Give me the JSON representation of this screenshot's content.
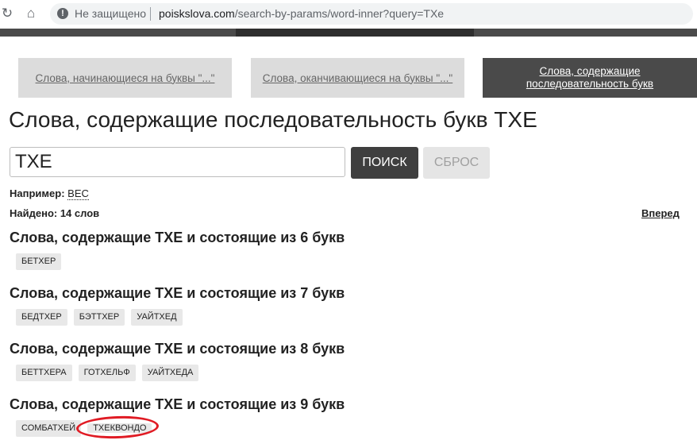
{
  "browser": {
    "security_label": "Не защищено",
    "url_host": "poiskslova.com",
    "url_path": "/search-by-params/word-inner?query=TXe"
  },
  "colors": {
    "tab_active": "#4a4a4a",
    "tab_inactive": "#dcdcdc",
    "chip_bg": "#e8e8e8",
    "annotation": "#e01b24"
  },
  "tabs": [
    {
      "label": "Слова, начинающиеся на буквы \"...\""
    },
    {
      "label": "Слова, оканчивающиеся на буквы \"...\""
    },
    {
      "label": "Слова, содержащие последовательность букв"
    }
  ],
  "page_title": "Слова, содержащие последовательность букв ТХЕ",
  "search": {
    "value": "ТХЕ",
    "search_button": "ПОИСК",
    "reset_button": "СБРОС"
  },
  "example": {
    "label": "Например:",
    "word": "ВЕС"
  },
  "found": "Найдено: 14 слов",
  "forward_link": "Вперед",
  "groups": [
    {
      "title": "Слова, содержащие ТХЕ и состоящие из 6 букв",
      "words": [
        "БЕТХЕР"
      ]
    },
    {
      "title": "Слова, содержащие ТХЕ и состоящие из 7 букв",
      "words": [
        "БЕДТХЕР",
        "БЭТТХЕР",
        "УАЙТХЕД"
      ]
    },
    {
      "title": "Слова, содержащие ТХЕ и состоящие из 8 букв",
      "words": [
        "БЕТТХЕРА",
        "ГОТХЕЛЬФ",
        "УАЙТХЕДА"
      ]
    },
    {
      "title": "Слова, содержащие ТХЕ и состоящие из 9 букв",
      "words": [
        "СОМБАТХЕЙ",
        "ТХЕКВОНДО"
      ]
    }
  ]
}
